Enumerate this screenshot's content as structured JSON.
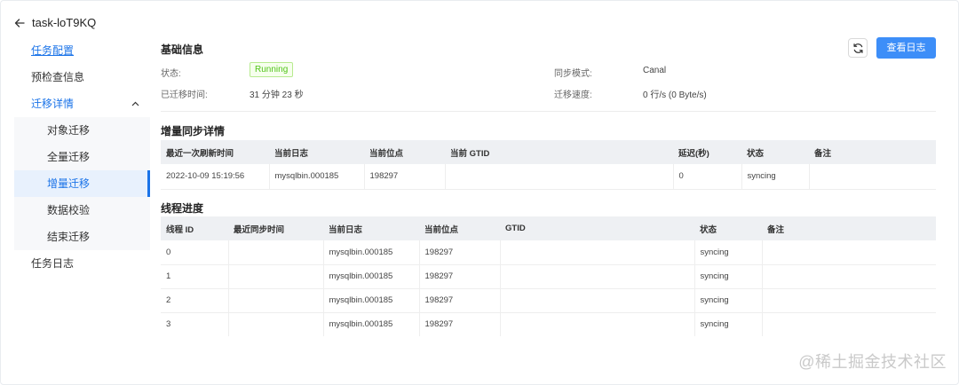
{
  "header": {
    "task_name": "task-loT9KQ"
  },
  "sidebar": {
    "items": [
      {
        "label": "任务配置"
      },
      {
        "label": "预检查信息"
      },
      {
        "label": "迁移详情"
      },
      {
        "label": "任务日志"
      }
    ],
    "sub_items": [
      {
        "label": "对象迁移"
      },
      {
        "label": "全量迁移"
      },
      {
        "label": "增量迁移"
      },
      {
        "label": "数据校验"
      },
      {
        "label": "结束迁移"
      }
    ]
  },
  "basic": {
    "title": "基础信息",
    "status_label": "状态:",
    "status_value": "Running",
    "elapsed_label": "已迁移时间:",
    "elapsed_value": "31 分钟 23 秒",
    "sync_mode_label": "同步模式:",
    "sync_mode_value": "Canal",
    "speed_label": "迁移速度:",
    "speed_value": "0 行/s (0 Byte/s)"
  },
  "toolbar": {
    "view_log_label": "查看日志"
  },
  "incremental": {
    "title": "增量同步详情",
    "columns": [
      "最近一次刷新时间",
      "当前日志",
      "当前位点",
      "当前 GTID",
      "延迟(秒)",
      "状态",
      "备注"
    ],
    "rows": [
      [
        "2022-10-09 15:19:56",
        "mysqlbin.000185",
        "198297",
        "",
        "0",
        "syncing",
        ""
      ]
    ]
  },
  "threads": {
    "title": "线程进度",
    "columns": [
      "线程 ID",
      "最近同步时间",
      "当前日志",
      "当前位点",
      "GTID",
      "状态",
      "备注"
    ],
    "rows": [
      [
        "0",
        "",
        "mysqlbin.000185",
        "198297",
        "",
        "syncing",
        ""
      ],
      [
        "1",
        "",
        "mysqlbin.000185",
        "198297",
        "",
        "syncing",
        ""
      ],
      [
        "2",
        "",
        "mysqlbin.000185",
        "198297",
        "",
        "syncing",
        ""
      ],
      [
        "3",
        "",
        "mysqlbin.000185",
        "198297",
        "",
        "syncing",
        ""
      ]
    ]
  },
  "watermark": "@稀土掘金技术社区",
  "colors": {
    "accent": "#3d8ef8",
    "running": "#52c41a"
  }
}
